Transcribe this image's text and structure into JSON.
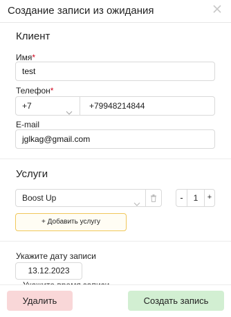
{
  "modal": {
    "title": "Создание записи из ожидания",
    "close_icon": "close-icon"
  },
  "client": {
    "section_title": "Клиент",
    "name_label": "Имя",
    "name_value": "test",
    "phone_label": "Телефон",
    "phone_code": "+7",
    "phone_number": "+79948214844",
    "email_label": "E-mail",
    "email_value": "jglkag@gmail.com",
    "required_mark": "*"
  },
  "services": {
    "section_title": "Услуги",
    "selected_service": "Boost Up",
    "quantity": "1",
    "minus_label": "-",
    "plus_label": "+",
    "add_service_label": "+ Добавить услугу"
  },
  "schedule": {
    "date_label": "Укажите дату записи",
    "date_value": "13.12.2023",
    "time_label": "Укажите время записи"
  },
  "footer": {
    "delete_label": "Удалить",
    "create_label": "Создать запись"
  },
  "colors": {
    "required": "#d0021b",
    "delete_bg": "#f9d7d8",
    "create_bg": "#d2efd2",
    "add_border": "#f0c75a"
  }
}
